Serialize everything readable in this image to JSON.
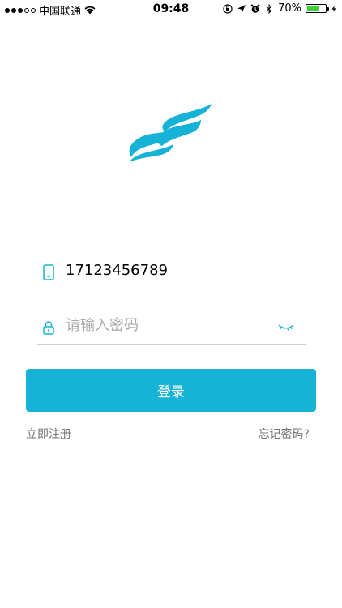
{
  "status_bar": {
    "carrier": "中国联通",
    "time": "09:48",
    "battery_percent": "70%",
    "battery_level": 0.7,
    "icons": [
      "signal-icon",
      "wifi-icon",
      "orientation-lock-icon",
      "location-icon",
      "alarm-icon",
      "bluetooth-icon",
      "battery-icon",
      "charging-icon"
    ]
  },
  "logo": {
    "icon": "app-logo-icon",
    "color": "#16b3d6"
  },
  "login_form": {
    "phone": {
      "icon": "phone-icon",
      "value": "17123456789"
    },
    "password": {
      "icon": "lock-icon",
      "placeholder": "请输入密码",
      "toggle_icon": "eye-closed-icon"
    },
    "submit_label": "登录",
    "register_label": "立即注册",
    "forgot_label": "忘记密码?"
  },
  "colors": {
    "accent": "#16b3d6",
    "link": "#777777",
    "divider": "#cfcfcf"
  }
}
